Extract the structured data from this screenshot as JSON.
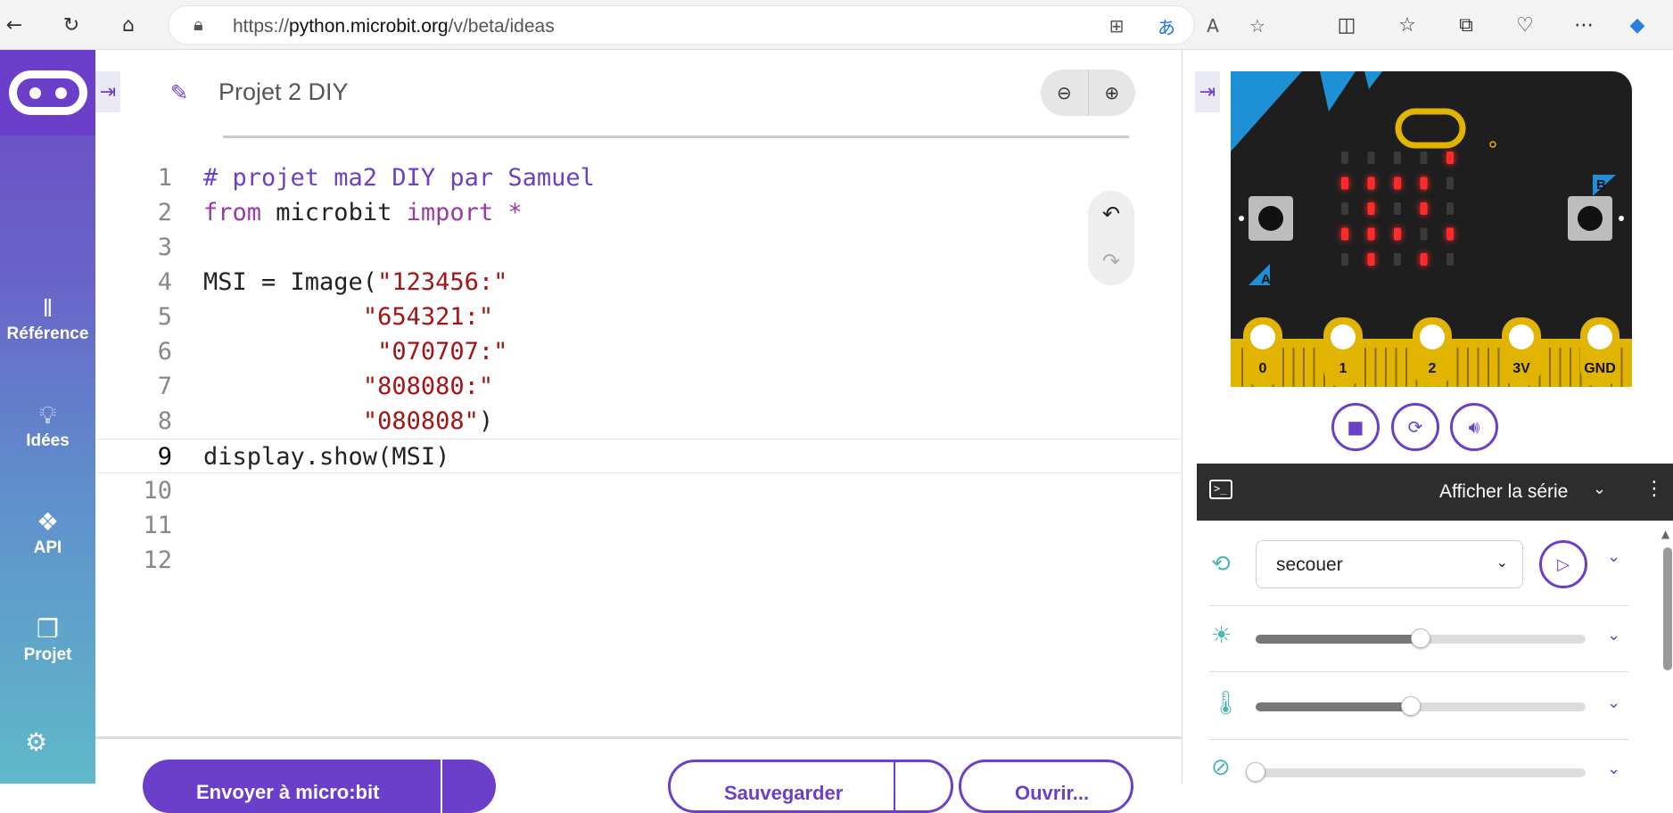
{
  "browser": {
    "url_prefix": "https://",
    "url_host": "python.microbit.org",
    "url_path": "/v/beta/ideas",
    "icons": [
      "back-arrow-icon",
      "refresh-icon",
      "home-icon",
      "lock-icon",
      "apps-icon",
      "translate-icon",
      "read-aloud-icon",
      "favorite-star-icon",
      "split-screen-icon",
      "favorites-icon",
      "collections-icon",
      "browser-essentials-icon",
      "more-icon",
      "copilot-icon"
    ]
  },
  "sidebar": {
    "items": [
      {
        "label": "Référence",
        "icon": "reference-books-icon"
      },
      {
        "label": "Idées",
        "icon": "lightbulb-icon"
      },
      {
        "label": "API",
        "icon": "python-icon"
      },
      {
        "label": "Projet",
        "icon": "project-files-icon"
      }
    ],
    "settings_icon": "gear-icon"
  },
  "editor": {
    "project_name": "Projet 2 DIY",
    "active_line": 9,
    "lines": [
      {
        "n": "1",
        "parts": [
          {
            "t": "# projet ma2 DIY par Samuel",
            "c": "cm"
          }
        ]
      },
      {
        "n": "2",
        "parts": [
          {
            "t": "from",
            "c": "kw"
          },
          {
            "t": " microbit ",
            "c": "tx"
          },
          {
            "t": "import",
            "c": "kw"
          },
          {
            "t": " *",
            "c": "kw"
          }
        ]
      },
      {
        "n": "3",
        "parts": []
      },
      {
        "n": "4",
        "parts": [
          {
            "t": "MSI = Image(",
            "c": "tx"
          },
          {
            "t": "\"123456:\"",
            "c": "st"
          }
        ]
      },
      {
        "n": "5",
        "parts": [
          {
            "t": "           ",
            "c": "tx"
          },
          {
            "t": "\"654321:\"",
            "c": "st"
          }
        ]
      },
      {
        "n": "6",
        "parts": [
          {
            "t": "            ",
            "c": "tx"
          },
          {
            "t": "\"070707:\"",
            "c": "st"
          }
        ]
      },
      {
        "n": "7",
        "parts": [
          {
            "t": "           ",
            "c": "tx"
          },
          {
            "t": "\"808080:\"",
            "c": "st"
          }
        ]
      },
      {
        "n": "8",
        "parts": [
          {
            "t": "           ",
            "c": "tx"
          },
          {
            "t": "\"080808\"",
            "c": "st"
          },
          {
            "t": ")",
            "c": "tx"
          }
        ]
      },
      {
        "n": "9",
        "parts": [
          {
            "t": "display.show(MSI)",
            "c": "tx"
          }
        ]
      },
      {
        "n": "10",
        "parts": []
      },
      {
        "n": "11",
        "parts": []
      },
      {
        "n": "12",
        "parts": []
      }
    ],
    "buttons": {
      "send": "Envoyer à micro:bit",
      "save": "Sauvegarder",
      "open": "Ouvrir..."
    }
  },
  "simulator": {
    "pins": [
      "0",
      "1",
      "2",
      "3V",
      "GND"
    ],
    "button_a": "A",
    "button_b": "B",
    "led_matrix": [
      [
        0,
        0,
        0,
        0,
        1
      ],
      [
        1,
        1,
        1,
        1,
        0
      ],
      [
        0,
        1,
        0,
        1,
        0
      ],
      [
        1,
        1,
        1,
        0,
        1
      ],
      [
        0,
        1,
        0,
        1,
        0
      ]
    ],
    "serial_label": "Afficher la série",
    "gesture_value": "secouer",
    "light_level": 0.5,
    "temperature_level": 0.47,
    "compass_level": 0.0,
    "colors": {
      "accent": "#6c3fcb",
      "board": "#1e1e1e",
      "gold": "#e0b400",
      "corner": "#1e90d6",
      "led_on": "#ff2b2b"
    }
  }
}
